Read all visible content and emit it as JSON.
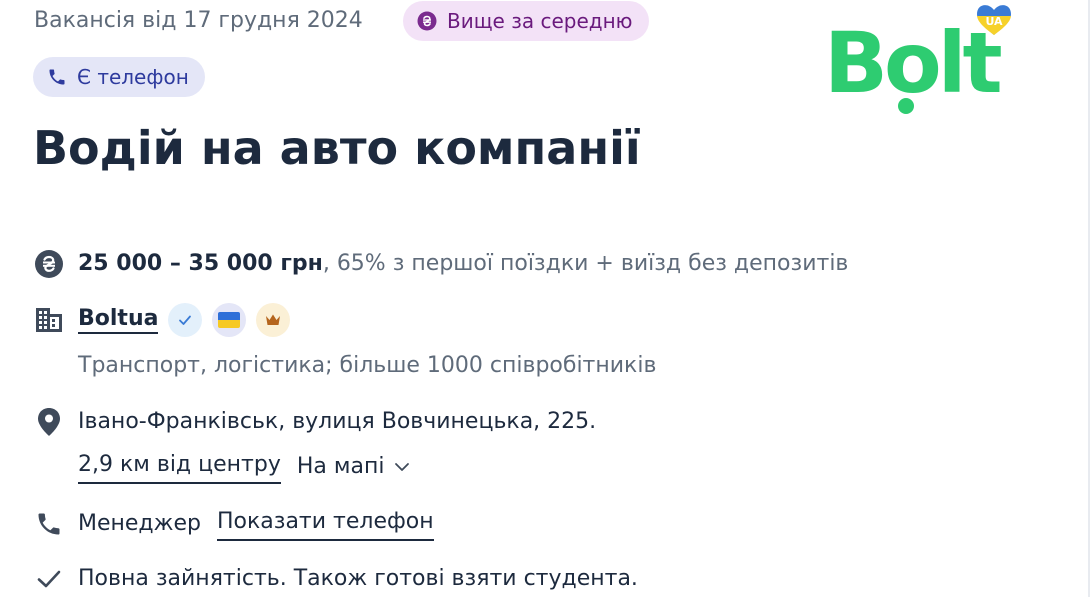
{
  "vacancy": {
    "date_text": "Вакансія від 17 грудня 2024",
    "salary_badge": "Вище за середню",
    "phone_badge": "Є телефон",
    "title": "Водій на авто компанії"
  },
  "logo": {
    "text": "Bolt",
    "badge_text": "UA",
    "color": "#2ecc71"
  },
  "salary": {
    "range": "25 000 – 35 000 грн",
    "details": ", 65% з першої поїздки + виїзд без депозитів"
  },
  "company": {
    "name": "Boltua",
    "description": "Транспорт, логістика; більше 1000 співробітників"
  },
  "location": {
    "address": "Івано-Франківськ, вулиця Вовчинецька, 225.",
    "distance": "2,9 км від центру",
    "map_label": "На мапі"
  },
  "contact": {
    "role": "Менеджер",
    "show_phone": "Показати телефон"
  },
  "employment": {
    "text": "Повна зайнятість. Також готові взяти студента."
  },
  "icons": {
    "salary": "hryvnia-icon",
    "phone": "phone-icon",
    "company": "building-icon",
    "verified": "checkmark-icon",
    "flag": "ukraine-flag-icon",
    "crown": "crown-icon",
    "location": "location-pin-icon",
    "chevron": "chevron-down-icon",
    "check": "check-icon"
  },
  "colors": {
    "text": "#1d2a3e",
    "muted": "#5f6b7a",
    "salary_badge_bg": "#f3e2f7",
    "salary_badge_fg": "#6a1a7d",
    "phone_badge_bg": "#e4e6f7",
    "phone_badge_fg": "#2e3b9e",
    "bolt_green": "#2ecc71"
  }
}
